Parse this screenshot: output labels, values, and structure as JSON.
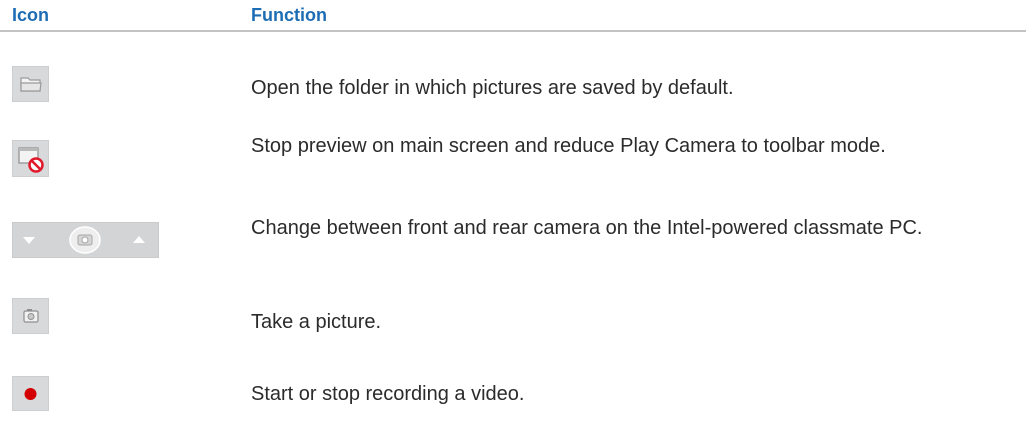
{
  "table": {
    "headers": {
      "icon": "Icon",
      "function": "Function"
    },
    "rows": [
      {
        "icon": "folder-icon",
        "description": "Open the folder in which pictures are saved by default."
      },
      {
        "icon": "stop-preview-icon",
        "description": "Stop preview on main screen and reduce Play Camera to toolbar mode."
      },
      {
        "icon": "switch-camera-icon",
        "description": "Change between front and rear  camera on the Intel-powered classmate PC."
      },
      {
        "icon": "camera-icon",
        "description": "Take a picture."
      },
      {
        "icon": "record-icon",
        "description": "Start or stop recording a video."
      }
    ]
  },
  "colors": {
    "header_text": "#1d6db5",
    "rule": "#c3c3c3",
    "icon_background": "#d8d9db",
    "record_dot": "#d40000",
    "stop_sign": "#e0192b"
  }
}
